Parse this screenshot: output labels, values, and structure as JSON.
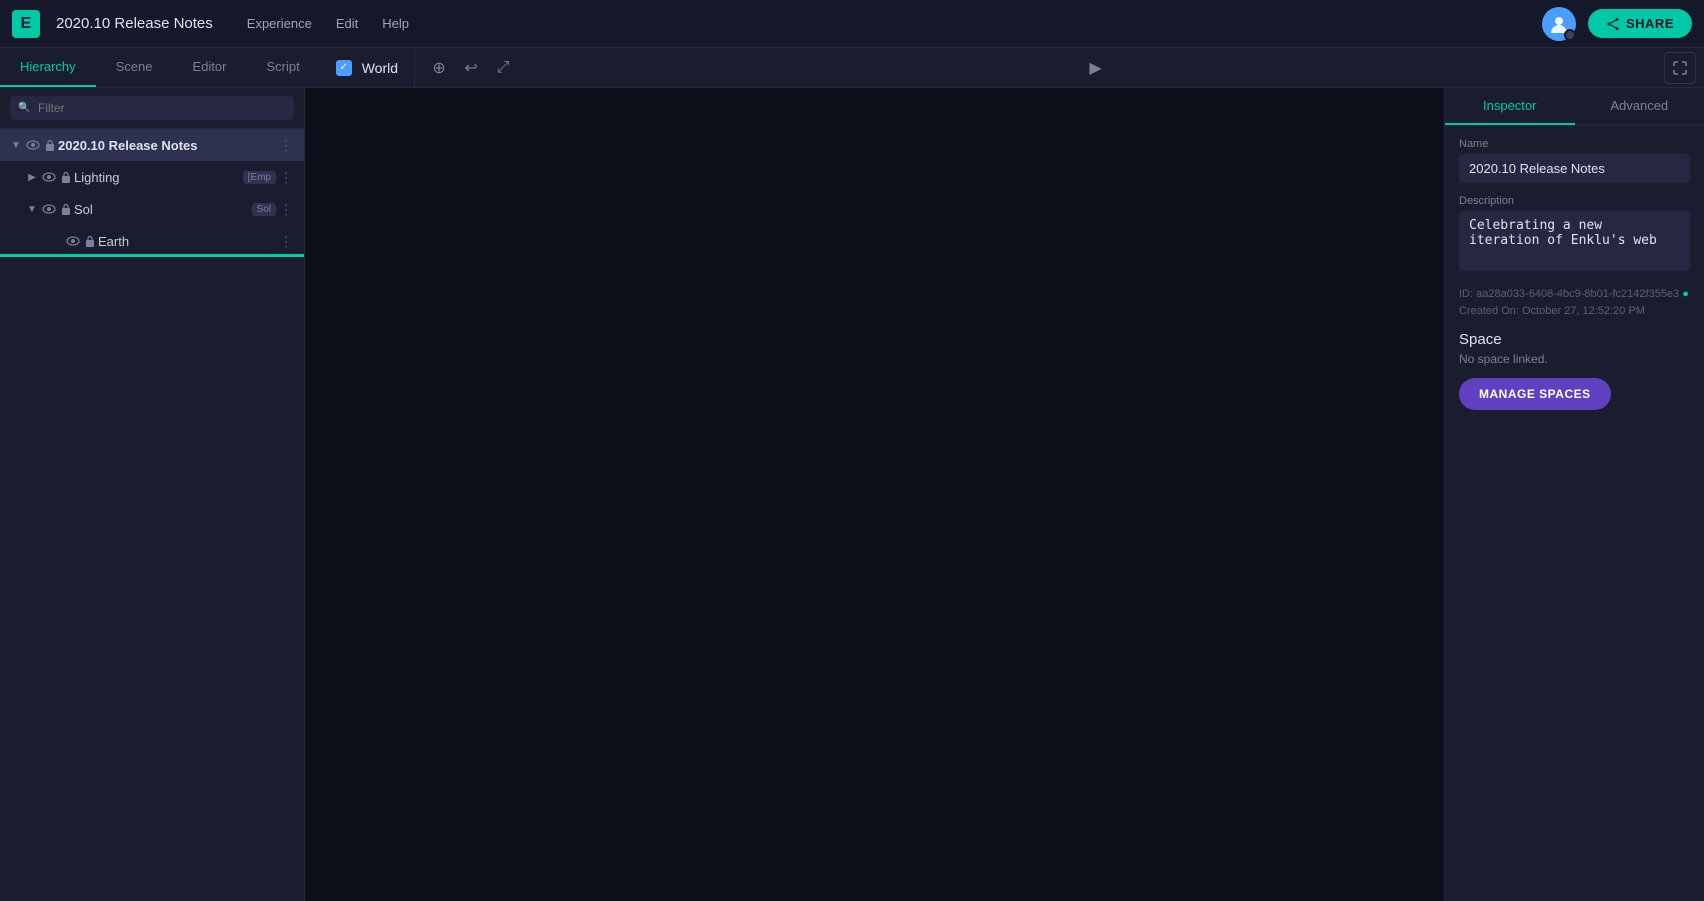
{
  "app": {
    "logo": "E",
    "title": "2020.10 Release Notes"
  },
  "top_nav": {
    "items": [
      {
        "label": "Experience",
        "id": "experience"
      },
      {
        "label": "Edit",
        "id": "edit"
      },
      {
        "label": "Help",
        "id": "help"
      }
    ]
  },
  "share_button": {
    "label": "SHARE",
    "icon": "share-icon"
  },
  "secondary_bar": {
    "tabs": [
      {
        "label": "Hierarchy",
        "id": "hierarchy",
        "active": true
      },
      {
        "label": "Scene",
        "id": "scene",
        "active": false
      },
      {
        "label": "Editor",
        "id": "editor",
        "active": false
      },
      {
        "label": "Script",
        "id": "script",
        "active": false
      }
    ],
    "world_label": "World",
    "toolbar": {
      "move_icon": "⊕",
      "undo_icon": "↩",
      "expand_icon": "⤢"
    }
  },
  "hierarchy": {
    "search_placeholder": "Filter",
    "items": [
      {
        "id": "release-notes",
        "label": "2020.10 Release Notes",
        "bold": true,
        "indent": 0,
        "expanded": true,
        "has_eye": true,
        "has_lock": true,
        "has_dots": true
      },
      {
        "id": "lighting",
        "label": "Lighting",
        "bold": false,
        "indent": 1,
        "expanded": false,
        "has_eye": true,
        "has_lock": true,
        "has_dots": true,
        "tag": "[Emp"
      },
      {
        "id": "sol",
        "label": "Sol",
        "bold": false,
        "indent": 1,
        "expanded": true,
        "has_eye": true,
        "has_lock": true,
        "has_dots": true,
        "tag": "Sol"
      },
      {
        "id": "earth",
        "label": "Earth",
        "bold": false,
        "indent": 2,
        "expanded": false,
        "has_eye": true,
        "has_lock": true,
        "has_dots": true
      }
    ]
  },
  "inspector": {
    "tabs": [
      {
        "label": "Inspector",
        "id": "inspector",
        "active": true
      },
      {
        "label": "Advanced",
        "id": "advanced",
        "active": false
      }
    ],
    "name_label": "Name",
    "name_value": "2020.10 Release Notes",
    "description_label": "Description",
    "description_value": "Celebrating a new iteration of Enklu's web",
    "meta_id": "ID: aa28a033-6408-4bc9-8b01-fc2142f355e3",
    "meta_created": "Created On: October 27, 12:52:20 PM",
    "space_heading": "Space",
    "space_sub": "No space linked.",
    "manage_button": "MANAGE SPACES"
  }
}
